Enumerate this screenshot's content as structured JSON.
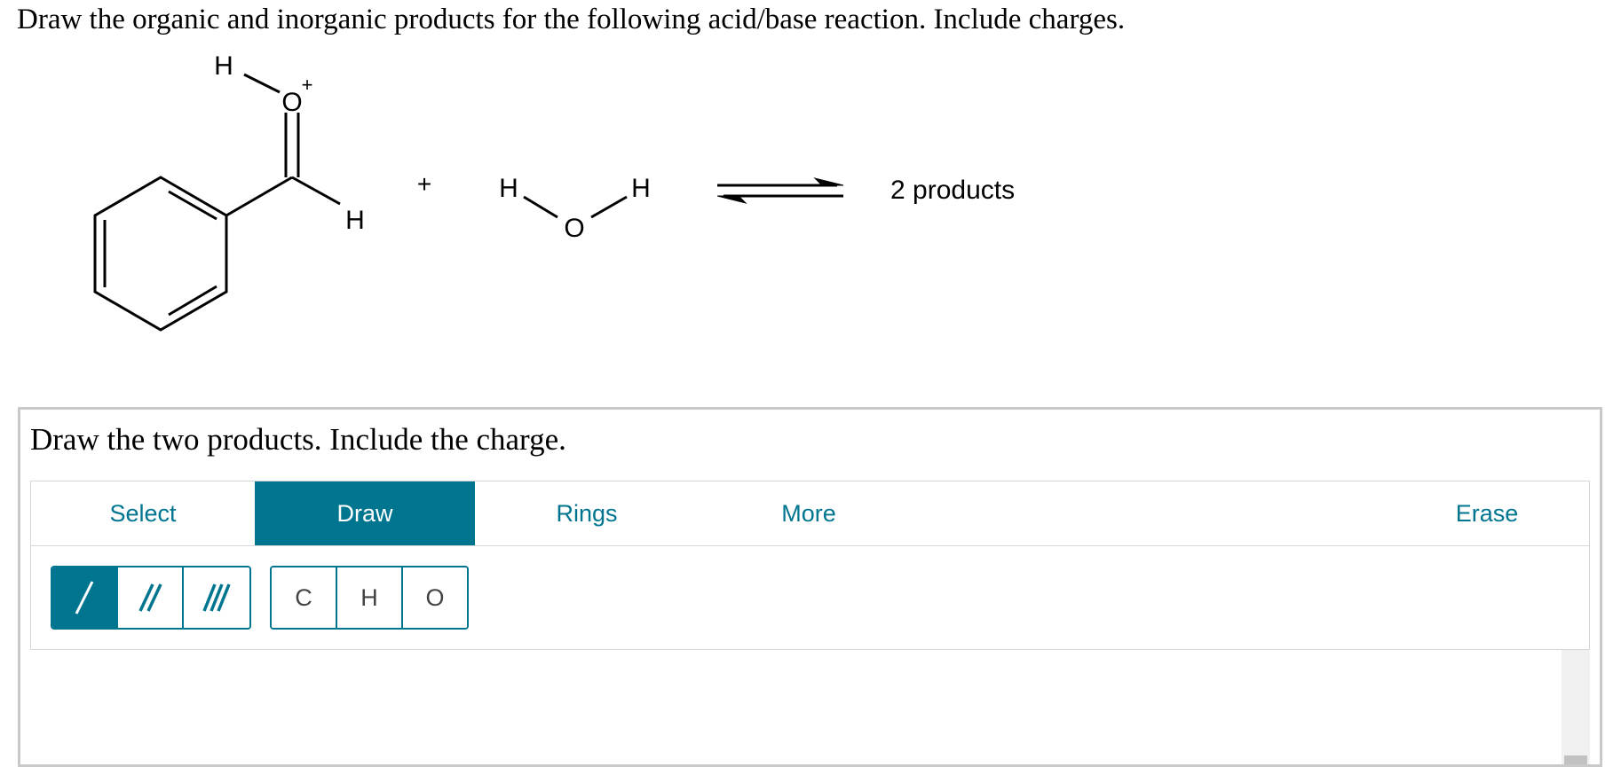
{
  "question": "Draw the organic and inorganic products for the following acid/base reaction. Include charges.",
  "reaction": {
    "plus": "+",
    "plus_charge": "+",
    "atoms": {
      "h": "H",
      "o": "O"
    },
    "products_label": "2 products"
  },
  "panel": {
    "prompt": "Draw the two products. Include the charge.",
    "tabs": [
      {
        "label": "Select",
        "active": false
      },
      {
        "label": "Draw",
        "active": true
      },
      {
        "label": "Rings",
        "active": false
      },
      {
        "label": "More",
        "active": false
      },
      {
        "label": "Erase",
        "active": false
      }
    ],
    "bond_tools": [
      {
        "name": "single-bond",
        "active": true
      },
      {
        "name": "double-bond",
        "active": false
      },
      {
        "name": "triple-bond",
        "active": false
      }
    ],
    "atom_tools": [
      "C",
      "H",
      "O"
    ]
  },
  "colors": {
    "accent": "#00758f",
    "panel_border": "#c9c9c9"
  }
}
